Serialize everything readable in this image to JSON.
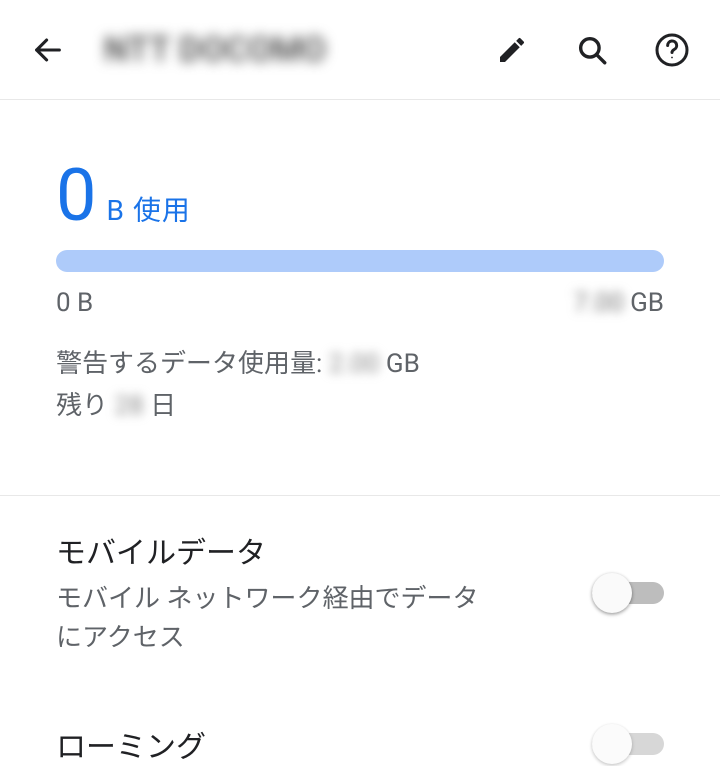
{
  "header": {
    "title": "NTT DOCOMO"
  },
  "usage": {
    "amount": "0",
    "unit_used": "B 使用",
    "scale_min": "0 B",
    "scale_max_value": "7.00",
    "scale_max_unit": "GB",
    "warning_prefix": "警告するデータ使用量: ",
    "warning_value": "2.00",
    "warning_unit": " GB",
    "remaining_prefix": "残り ",
    "remaining_value": "28",
    "remaining_suffix": " 日"
  },
  "settings": {
    "mobile_data": {
      "title": "モバイルデータ",
      "subtitle": "モバイル ネットワーク経由でデータにアクセス",
      "enabled": false
    },
    "roaming": {
      "title": "ローミング",
      "enabled": false
    }
  }
}
